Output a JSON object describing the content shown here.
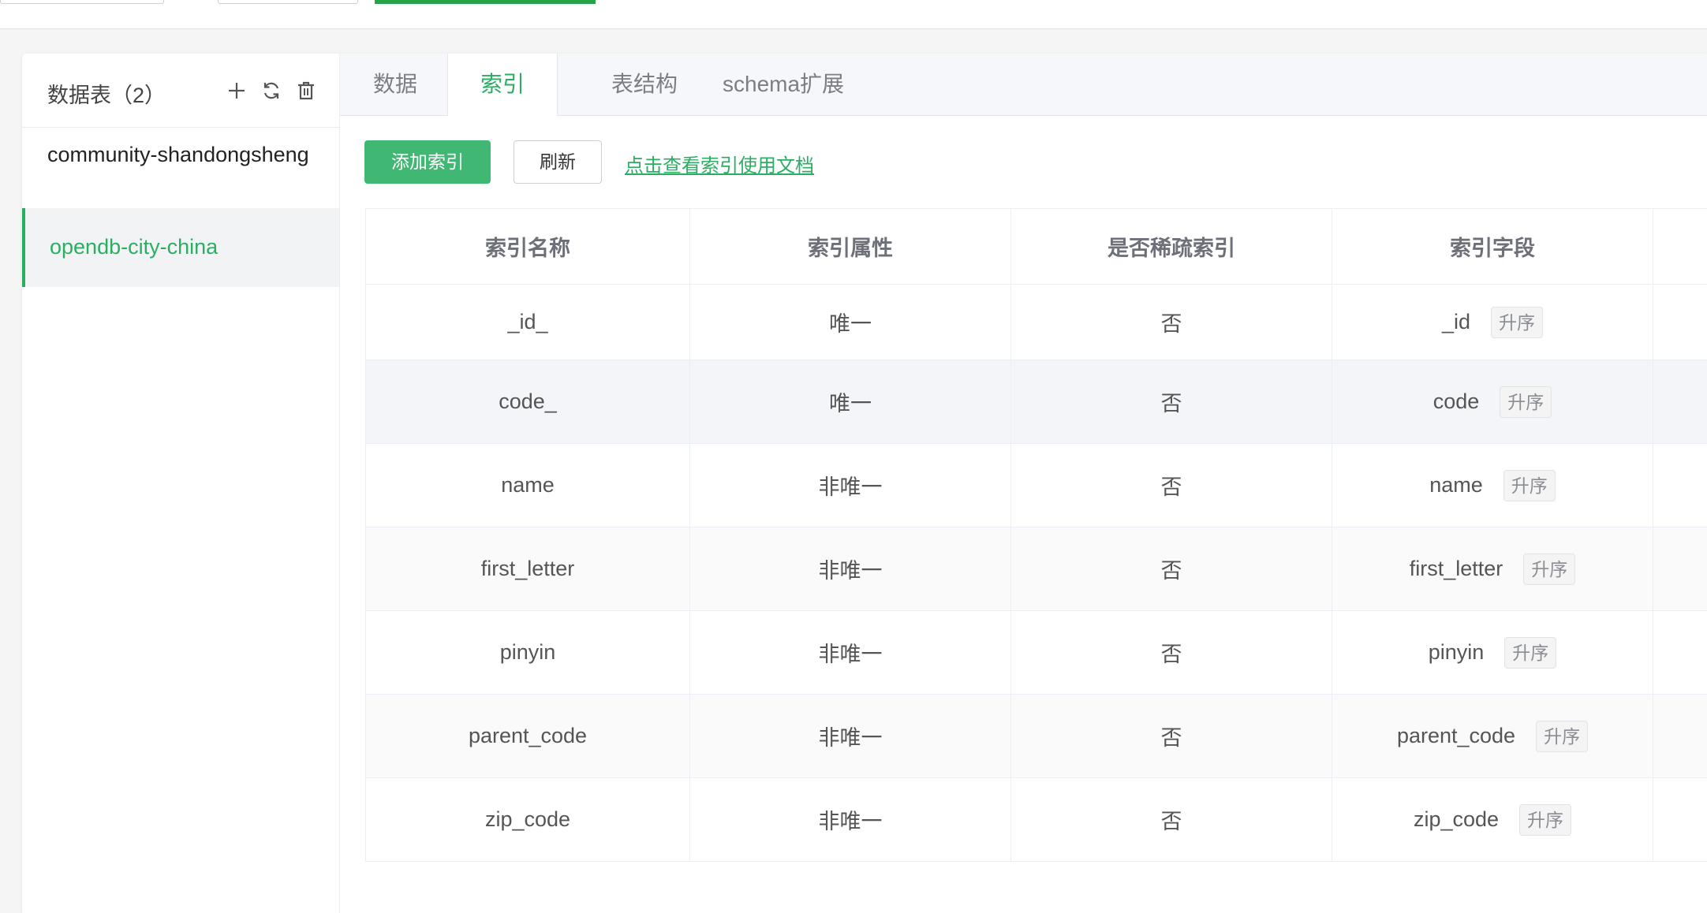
{
  "sidebar": {
    "title": "数据表（2）",
    "items": [
      {
        "label": "community-shandongsheng"
      },
      {
        "label": "opendb-city-china"
      }
    ],
    "icons": [
      "plus-icon",
      "refresh-icon",
      "trash-icon"
    ]
  },
  "tabs": [
    {
      "label": "数据"
    },
    {
      "label": "索引",
      "active": true
    },
    {
      "label": "表结构"
    },
    {
      "label": "schema扩展"
    }
  ],
  "toolbar": {
    "add_label": "添加索引",
    "refresh_label": "刷新",
    "doc_link": "点击查看索引使用文档"
  },
  "table": {
    "headers": [
      "索引名称",
      "索引属性",
      "是否稀疏索引",
      "索引字段"
    ],
    "rows": [
      {
        "name": "_id_",
        "attr": "唯一",
        "sparse": "否",
        "field": "_id",
        "order": "升序"
      },
      {
        "name": "code_",
        "attr": "唯一",
        "sparse": "否",
        "field": "code",
        "order": "升序"
      },
      {
        "name": "name",
        "attr": "非唯一",
        "sparse": "否",
        "field": "name",
        "order": "升序"
      },
      {
        "name": "first_letter",
        "attr": "非唯一",
        "sparse": "否",
        "field": "first_letter",
        "order": "升序"
      },
      {
        "name": "pinyin",
        "attr": "非唯一",
        "sparse": "否",
        "field": "pinyin",
        "order": "升序"
      },
      {
        "name": "parent_code",
        "attr": "非唯一",
        "sparse": "否",
        "field": "parent_code",
        "order": "升序"
      },
      {
        "name": "zip_code",
        "attr": "非唯一",
        "sparse": "否",
        "field": "zip_code",
        "order": "升序"
      }
    ]
  },
  "colors": {
    "accent": "#2bae64",
    "button": "#40b874",
    "progress": "#27a34a"
  }
}
